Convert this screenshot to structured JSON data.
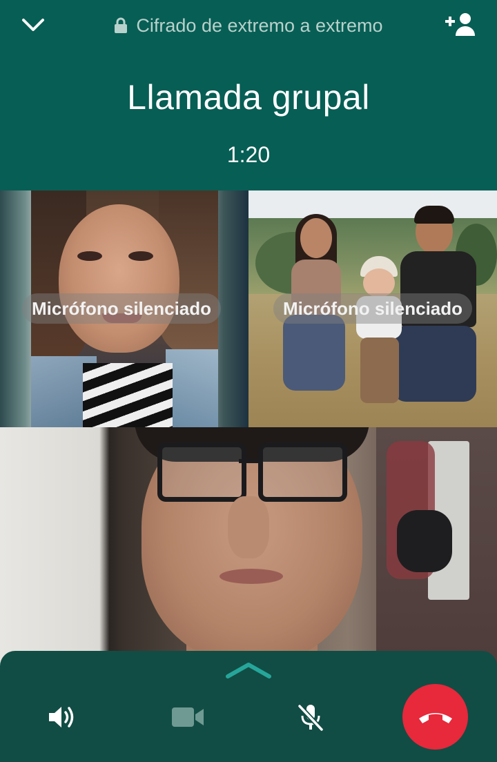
{
  "header": {
    "encryption_label": "Cifrado de extremo a extremo",
    "title": "Llamada grupal",
    "timer": "1:20",
    "icons": {
      "collapse": "chevron-down-icon",
      "lock": "lock-icon",
      "add_participant": "add-person-icon"
    }
  },
  "participants": [
    {
      "muted_label": "Micrófono silenciado",
      "muted": true
    },
    {
      "muted_label": "Micrófono silenciado",
      "muted": true
    },
    {
      "muted": false
    }
  ],
  "controls": {
    "icons": [
      "chevron-up-icon",
      "speaker-icon",
      "video-camera-icon",
      "mic-off-icon",
      "end-call-icon"
    ],
    "colors": {
      "end_call": "#e8283b",
      "panel": "#114d44",
      "accent": "#26a69a",
      "video_disabled": "#6f9a93"
    }
  },
  "colors": {
    "header_bg": "#075e54",
    "text": "#ffffff",
    "subtle_text": "#b9d1cc"
  }
}
